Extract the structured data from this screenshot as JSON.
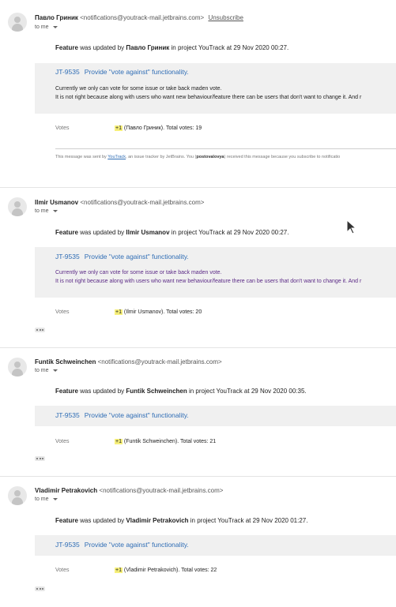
{
  "messages": [
    {
      "sender_name": "Павло Гриник",
      "sender_email": "<notifications@youtrack-mail.jetbrains.com>",
      "unsubscribe": "Unsubscribe",
      "to_me": "to me",
      "update_prefix": "Feature",
      "update_mid": " was updated by ",
      "update_user": "Павло Гриник",
      "update_suffix": " in project YouTrack at 29 Nov 2020 00:27.",
      "issue_id": "JT-9535",
      "issue_title": "Provide \"vote against\" functionality.",
      "desc_line1": "Currently we only can vote for some issue or take back maden vote.",
      "desc_line2": "It is not right because along with users who want new behaviour/feature there can be users that don't want to change it. And r",
      "votes_label": "Votes",
      "votes_plus": "+1",
      "votes_text": " (Павло Гриник). Total votes: 19",
      "footer_prefix": "This message was sent by ",
      "footer_link": "YouTrack",
      "footer_mid": ", an issue tracker by JetBrains. You (",
      "footer_user": "postovalovya",
      "footer_suffix": ") received this message because you subscribe to notificatio"
    },
    {
      "sender_name": "Ilmir Usmanov",
      "sender_email": "<notifications@youtrack-mail.jetbrains.com>",
      "to_me": "to me",
      "update_prefix": "Feature",
      "update_mid": " was updated by ",
      "update_user": "Ilmir Usmanov",
      "update_suffix": " in project YouTrack at 29 Nov 2020 00:27.",
      "issue_id": "JT-9535",
      "issue_title": "Provide \"vote against\" functionality.",
      "desc_line1": "Currently we only can vote for some issue or take back maden vote.",
      "desc_line2": "It is not right because along with users who want new behaviour/feature there can be users that don't want to change it. And r",
      "votes_label": "Votes",
      "votes_plus": "+1",
      "votes_text": " (Ilmir Usmanov). Total votes: 20"
    },
    {
      "sender_name": "Funtik Schweinchen",
      "sender_email": "<notifications@youtrack-mail.jetbrains.com>",
      "to_me": "to me",
      "update_prefix": "Feature",
      "update_mid": " was updated by ",
      "update_user": "Funtik Schweinchen",
      "update_suffix": " in project YouTrack at 29 Nov 2020 00:35.",
      "issue_id": "JT-9535",
      "issue_title": "Provide \"vote against\" functionality.",
      "votes_label": "Votes",
      "votes_plus": "+1",
      "votes_text": " (Funtik Schweinchen). Total votes: 21"
    },
    {
      "sender_name": "Vladimir Petrakovich",
      "sender_email": "<notifications@youtrack-mail.jetbrains.com>",
      "to_me": "to me",
      "update_prefix": "Feature",
      "update_mid": " was updated by ",
      "update_user": "Vladimir Petrakovich",
      "update_suffix": " in project YouTrack at 29 Nov 2020 01:27.",
      "issue_id": "JT-9535",
      "issue_title": "Provide \"vote against\" functionality.",
      "votes_label": "Votes",
      "votes_plus": "+1",
      "votes_text": " (Vladimir Petrakovich). Total votes: 22"
    }
  ],
  "colors": {
    "link": "#2f6db5",
    "highlight": "#f7f07a",
    "box": "#f0f0f0"
  },
  "icons": {
    "avatar": "avatar-icon",
    "expand": "chevron-down-icon",
    "more": "more-dots-icon",
    "cursor": "mouse-cursor-icon"
  }
}
